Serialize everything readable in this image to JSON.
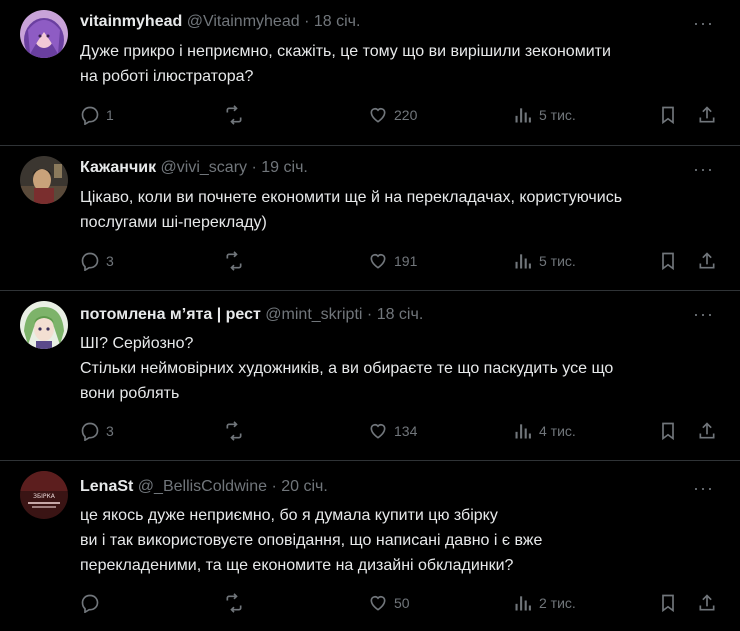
{
  "tweets": [
    {
      "name": "vitainmyhead",
      "handle": "@Vitainmyhead",
      "time": "18 січ.",
      "lines": [
        "Дуже прикро і неприємно, скажіть, це тому що ви вирішили зекономити",
        "на роботі ілюстратора?"
      ],
      "replies": "1",
      "likes": "220",
      "views": "5 тис."
    },
    {
      "name": "Кажанчик",
      "handle": "@vivi_scary",
      "time": "19 січ.",
      "lines": [
        "Цікаво, коли ви почнете економити ще й на перекладачах, користуючись",
        "послугами ші-перекладу)"
      ],
      "replies": "3",
      "likes": "191",
      "views": "5 тис."
    },
    {
      "name": "потомлена м’ята | рест",
      "handle": "@mint_skripti",
      "time": "18 січ.",
      "lines": [
        "ШІ? Серйозно?",
        "Стільки неймовірних художників, а ви обираєте те що паскудить усе що",
        "вони роблять"
      ],
      "replies": "3",
      "likes": "134",
      "views": "4 тис."
    },
    {
      "name": "LenaSt",
      "handle": "@_BellisColdwine",
      "time": "20 січ.",
      "lines": [
        "це якось дуже неприємно, бо я думала купити цю збірку",
        "ви і так використовуєте оповідання, що написані давно і є вже",
        "перекладеними, та ще економите на дизайні обкладинки?"
      ],
      "replies": "",
      "likes": "50",
      "views": "2 тис.",
      "avatar_text": "ЗБІРКА"
    }
  ],
  "colors": {
    "background": "#000000",
    "text": "#e7e9ea",
    "muted": "#71767b",
    "divider": "#2f3336"
  },
  "icons": [
    "reply-icon",
    "retweet-icon",
    "like-icon",
    "views-icon",
    "bookmark-icon",
    "share-icon",
    "more-icon"
  ]
}
